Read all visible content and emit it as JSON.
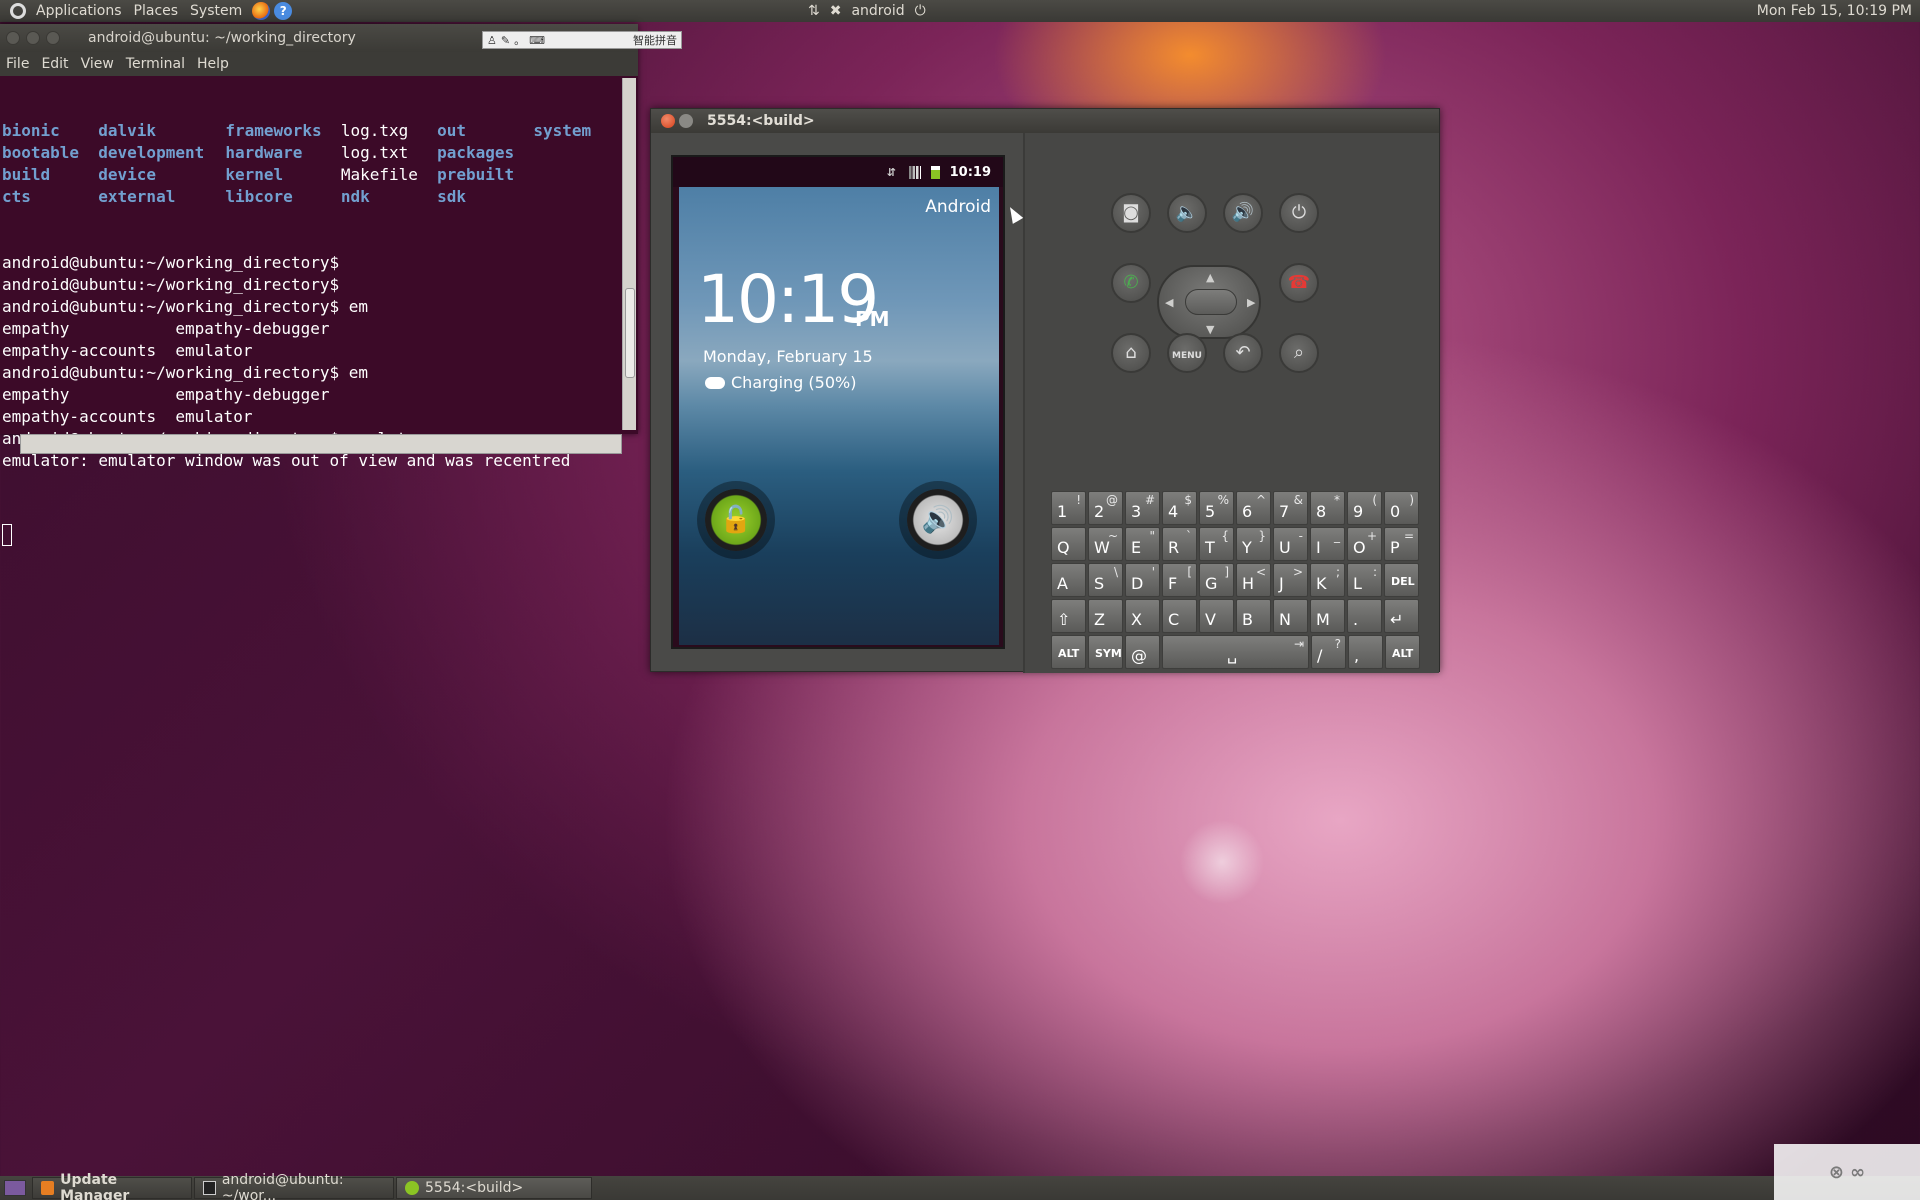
{
  "top_panel": {
    "menus": [
      "Applications",
      "Places",
      "System"
    ],
    "user": "android",
    "clock": "Mon Feb 15, 10:19 PM"
  },
  "terminal": {
    "title": "android@ubuntu: ~/working_directory",
    "menu": [
      "File",
      "Edit",
      "View",
      "Terminal",
      "Help"
    ],
    "ime_label": "智能拼音",
    "ls_rows": [
      [
        {
          "t": "bionic",
          "dir": true
        },
        {
          "t": "dalvik",
          "dir": true
        },
        {
          "t": "frameworks",
          "dir": true
        },
        {
          "t": "log.txg",
          "dir": false
        },
        {
          "t": "out",
          "dir": true
        },
        {
          "t": "system",
          "dir": true
        }
      ],
      [
        {
          "t": "bootable",
          "dir": true
        },
        {
          "t": "development",
          "dir": true
        },
        {
          "t": "hardware",
          "dir": true
        },
        {
          "t": "log.txt",
          "dir": false
        },
        {
          "t": "packages",
          "dir": true
        },
        {
          "t": "",
          "dir": false
        }
      ],
      [
        {
          "t": "build",
          "dir": true
        },
        {
          "t": "device",
          "dir": true
        },
        {
          "t": "kernel",
          "dir": true
        },
        {
          "t": "Makefile",
          "dir": false
        },
        {
          "t": "prebuilt",
          "dir": true
        },
        {
          "t": "",
          "dir": false
        }
      ],
      [
        {
          "t": "cts",
          "dir": true
        },
        {
          "t": "external",
          "dir": true
        },
        {
          "t": "libcore",
          "dir": true
        },
        {
          "t": "ndk",
          "dir": true
        },
        {
          "t": "sdk",
          "dir": true
        },
        {
          "t": "",
          "dir": false
        }
      ]
    ],
    "lines": [
      "android@ubuntu:~/working_directory$",
      "android@ubuntu:~/working_directory$",
      "android@ubuntu:~/working_directory$ em",
      "empathy           empathy-debugger",
      "empathy-accounts  emulator",
      "android@ubuntu:~/working_directory$ em",
      "empathy           empathy-debugger",
      "empathy-accounts  emulator",
      "android@ubuntu:~/working_directory$ emulator",
      "emulator: emulator window was out of view and was recentred"
    ]
  },
  "emulator": {
    "title": "5554:<build>",
    "status_time": "10:19",
    "carrier": "Android",
    "lock_time": "10:19",
    "lock_ampm": "PM",
    "lock_date": "Monday, February 15",
    "charging": "Charging (50%)",
    "menu_key": "MENU",
    "keyboard": [
      [
        [
          "1",
          "!"
        ],
        [
          "2",
          "@"
        ],
        [
          "3",
          "#"
        ],
        [
          "4",
          "$"
        ],
        [
          "5",
          "%"
        ],
        [
          "6",
          "^"
        ],
        [
          "7",
          "&"
        ],
        [
          "8",
          "*"
        ],
        [
          "9",
          "("
        ],
        [
          "0",
          ")"
        ]
      ],
      [
        [
          "Q",
          ""
        ],
        [
          "W",
          "~"
        ],
        [
          "E",
          "\""
        ],
        [
          "R",
          "`"
        ],
        [
          "T",
          "{"
        ],
        [
          "Y",
          "}"
        ],
        [
          "U",
          "-"
        ],
        [
          "I",
          "_"
        ],
        [
          "O",
          "+"
        ],
        [
          "P",
          "="
        ]
      ],
      [
        [
          "A",
          ""
        ],
        [
          "S",
          "\\"
        ],
        [
          "D",
          "'"
        ],
        [
          "F",
          "["
        ],
        [
          "G",
          "]"
        ],
        [
          "H",
          "<"
        ],
        [
          "J",
          ">"
        ],
        [
          "K",
          ";"
        ],
        [
          "L",
          ":"
        ],
        [
          "DEL",
          ""
        ]
      ],
      [
        [
          "⇧",
          ""
        ],
        [
          "Z",
          ""
        ],
        [
          "X",
          ""
        ],
        [
          "C",
          ""
        ],
        [
          "V",
          ""
        ],
        [
          "B",
          ""
        ],
        [
          "N",
          ""
        ],
        [
          "M",
          ""
        ],
        [
          ".",
          ""
        ],
        [
          "↵",
          ""
        ]
      ],
      [
        [
          "ALT",
          ""
        ],
        [
          "SYM",
          ""
        ],
        [
          "@",
          ""
        ],
        [
          "␣",
          "⇥"
        ],
        [
          "/",
          "?"
        ],
        [
          ",",
          ""
        ],
        [
          "ALT",
          ""
        ]
      ]
    ]
  },
  "taskbar": {
    "items": [
      "Update Manager",
      "android@ubuntu: ~/wor...",
      "5554:<build>"
    ]
  },
  "colors": {
    "terminal_bg": "#3c0a28",
    "dir_blue": "#729fcf",
    "unlock_green": "#8bc424"
  }
}
